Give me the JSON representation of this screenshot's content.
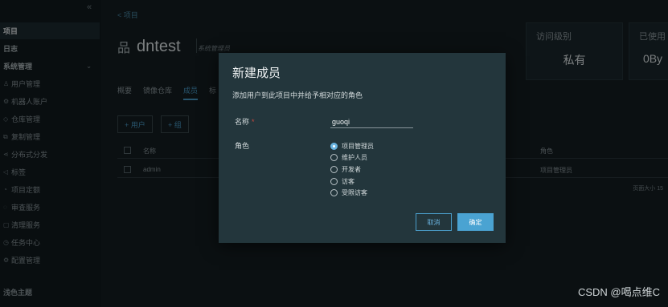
{
  "sidebar": {
    "collapse_icon": "double-chevron-left-icon",
    "items": [
      {
        "label": "项目",
        "active": true
      },
      {
        "label": "日志"
      },
      {
        "label": "系统管理",
        "group": true
      },
      {
        "label": "用户管理"
      },
      {
        "label": "机器人账户"
      },
      {
        "label": "仓库管理"
      },
      {
        "label": "复制管理"
      },
      {
        "label": "分布式分发"
      },
      {
        "label": "标签"
      },
      {
        "label": "项目定额"
      },
      {
        "label": "审查服务"
      },
      {
        "label": "清理服务"
      },
      {
        "label": "任务中心"
      },
      {
        "label": "配置管理"
      }
    ],
    "theme": "浅色主题"
  },
  "main": {
    "breadcrumb": "< 项目",
    "project_name": "dntest",
    "project_sub": "系统管理员",
    "cards": [
      {
        "title": "访问级别",
        "value": "私有"
      },
      {
        "title": "已使用",
        "value": "0By"
      }
    ],
    "tabs": [
      "概要",
      "镜像仓库",
      "成员",
      "标"
    ],
    "add_user_btn": "+ 用户",
    "group_btn": "+ 组",
    "table": {
      "headers": [
        "名称",
        "角色"
      ],
      "rows": [
        {
          "name": "admin",
          "role": "项目管理员"
        }
      ]
    },
    "pager": "页面大小 15"
  },
  "modal": {
    "title": "新建成员",
    "description": "添加用户到此项目中并给予相对应的角色",
    "name_label": "名称",
    "name_required": "*",
    "name_value": "guoqi",
    "role_label": "角色",
    "roles": [
      {
        "label": "项目管理员",
        "selected": true
      },
      {
        "label": "维护人员"
      },
      {
        "label": "开发者"
      },
      {
        "label": "访客"
      },
      {
        "label": "受限访客"
      }
    ],
    "cancel": "取消",
    "ok": "确定"
  },
  "watermark": "CSDN @喝点维C"
}
